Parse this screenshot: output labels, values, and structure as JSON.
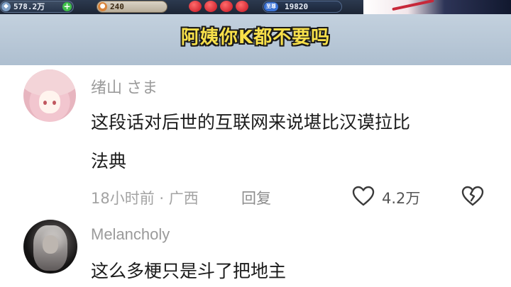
{
  "video": {
    "coins": "578.2万",
    "plus": "+",
    "energy": "240",
    "gems_label": "至尊",
    "gems": "19820",
    "subtitle": "阿姨你K都不要吗"
  },
  "comments": [
    {
      "username": "绪山 さま",
      "lines": [
        "这段话对后世的互联网来说堪比汉谟拉比",
        "法典"
      ],
      "time_location": "18小时前 · 广西",
      "reply_label": "回复",
      "likes": "4.2万"
    },
    {
      "username": "Melancholy",
      "lines": [
        "这么多梗只是斗了把地主"
      ]
    }
  ],
  "icons": {
    "like": "heart-outline-icon",
    "dislike": "broken-heart-icon"
  },
  "colors": {
    "subtitle_fill": "#f8e04a",
    "username": "#9a9a9a",
    "text": "#1b1b1b"
  }
}
